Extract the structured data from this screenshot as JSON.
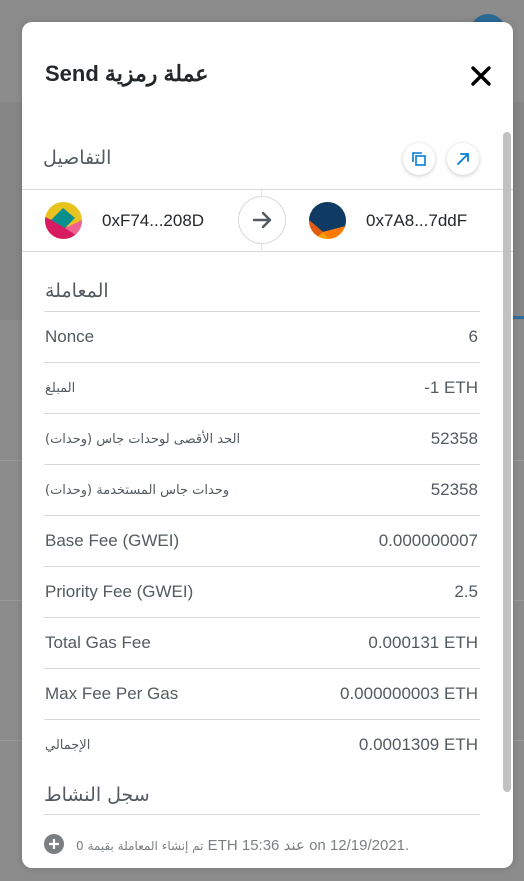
{
  "modal": {
    "title": "عملة رمزية Send",
    "close_icon": "close-icon"
  },
  "details": {
    "label": "التفاصيل",
    "copy_icon": "copy-icon",
    "open_icon": "external-link-icon"
  },
  "sender": {
    "from_address": "0xF74...208D",
    "to_address": "0x7A8...7ddF",
    "arrow_icon": "arrow-right-icon"
  },
  "transaction": {
    "title": "المعاملة",
    "rows": [
      {
        "key": "Nonce",
        "value": "6"
      },
      {
        "key": "المبلغ",
        "value": "-1 ETH"
      },
      {
        "key": "الحد الأقصى لوحدات جاس (وحدات)",
        "value": "52358"
      },
      {
        "key": "وحدات جاس المستخدمة (وحدات)",
        "value": "52358"
      },
      {
        "key": "Base Fee (GWEI)",
        "value": "0.000000007"
      },
      {
        "key": "Priority Fee (GWEI)",
        "value": "2.5"
      },
      {
        "key": "Total Gas Fee",
        "value": "0.000131 ETH"
      },
      {
        "key": "Max Fee Per Gas",
        "value": "0.000000003 ETH"
      },
      {
        "key": "الإجمالي",
        "value": "0.0001309 ETH"
      }
    ]
  },
  "activity": {
    "title": "سجل النشاط",
    "item_prefix": "تم إنشاء المعاملة بقيمة 0",
    "item_suffix": " ETH 15:36 عند on 12/19/2021."
  },
  "colors": {
    "overlay": "#8c8c8c",
    "text_primary": "#24272a",
    "text_secondary": "#535a61",
    "divider": "#d6d9dc",
    "link_blue": "#037dd6"
  }
}
